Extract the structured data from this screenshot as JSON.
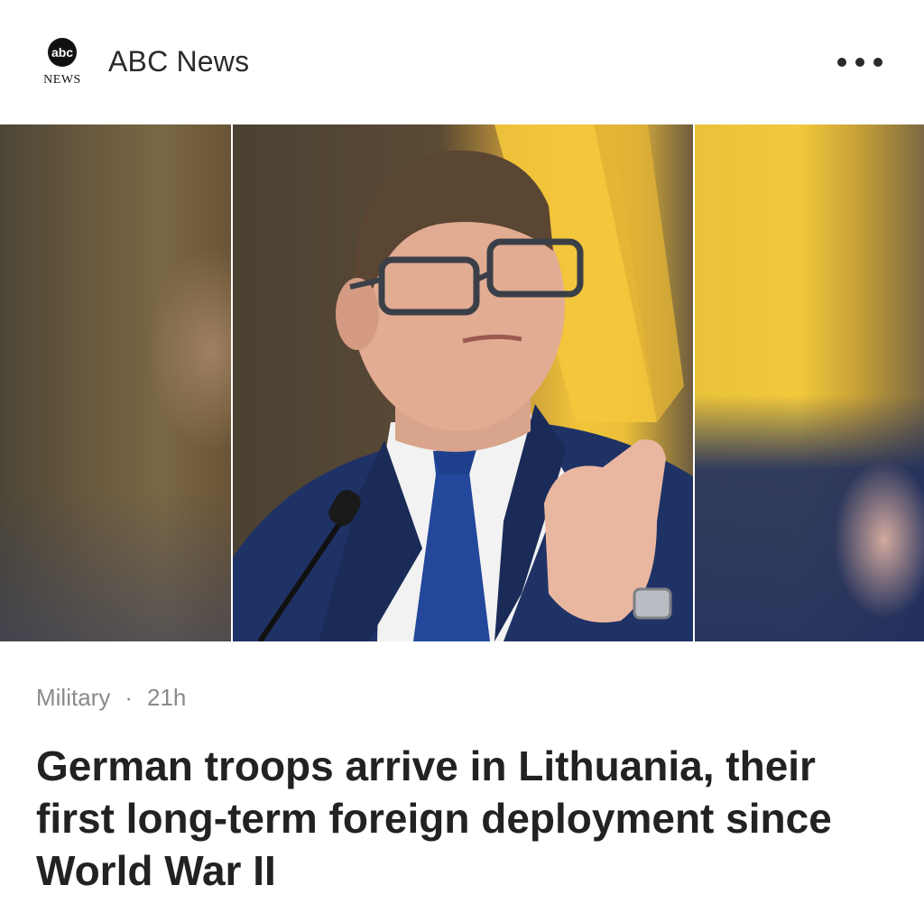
{
  "header": {
    "source_name": "ABC News",
    "logo_text_top": "abc",
    "logo_text_bottom": "NEWS",
    "more_icon": "more-horizontal-icon"
  },
  "article": {
    "category": "Military",
    "separator": "·",
    "age": "21h",
    "headline": "German troops arrive in Lithuania, their first long-term foreign deployment since World War II",
    "image_icon": "article-photo"
  },
  "colors": {
    "headline": "#222222",
    "meta": "#8a8a8e",
    "accent_yellow": "#f0c43a",
    "suit_blue": "#1f3266"
  }
}
